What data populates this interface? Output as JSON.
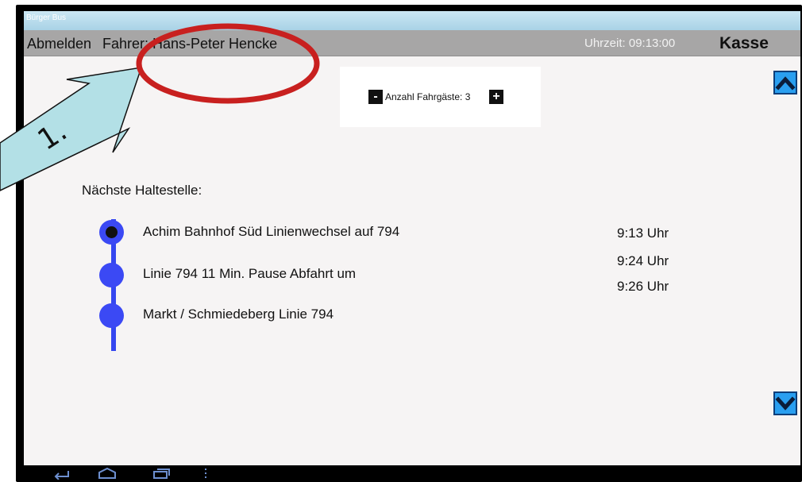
{
  "app": {
    "title": "Bürger Bus"
  },
  "topbar": {
    "logout_label": "Abmelden",
    "driver_text": "Fahrer: Hans-Peter Hencke",
    "clock_text": "Uhrzeit: 09:13:00",
    "kasse_label": "Kasse"
  },
  "passengers": {
    "label": "Anzahl Fahrgäste: 3",
    "minus": "-",
    "plus": "+"
  },
  "stops": {
    "heading": "Nächste Haltestelle:",
    "items": [
      {
        "name": "Achim Bahnhof Süd Linienwechsel auf 794",
        "current": true
      },
      {
        "name": "Linie 794 11 Min. Pause   Abfahrt um",
        "current": false
      },
      {
        "name": "Markt / Schmiedeberg Linie 794",
        "current": false
      }
    ],
    "times": [
      "9:13 Uhr",
      "9:24 Uhr",
      "9:26 Uhr"
    ]
  },
  "annotation": {
    "label": "1.",
    "arrow_color": "#b3e0e6",
    "circle_color": "#c8201f"
  },
  "colors": {
    "accent": "#3b49f4",
    "scroll_button": "#2a9ff0",
    "topbar": "#a7a6a6"
  },
  "icons": {
    "up": "chevron-up-icon",
    "down": "chevron-down-icon",
    "back": "back-icon",
    "home": "home-icon",
    "recents": "recent-apps-icon",
    "menu": "menu-dots-icon"
  }
}
